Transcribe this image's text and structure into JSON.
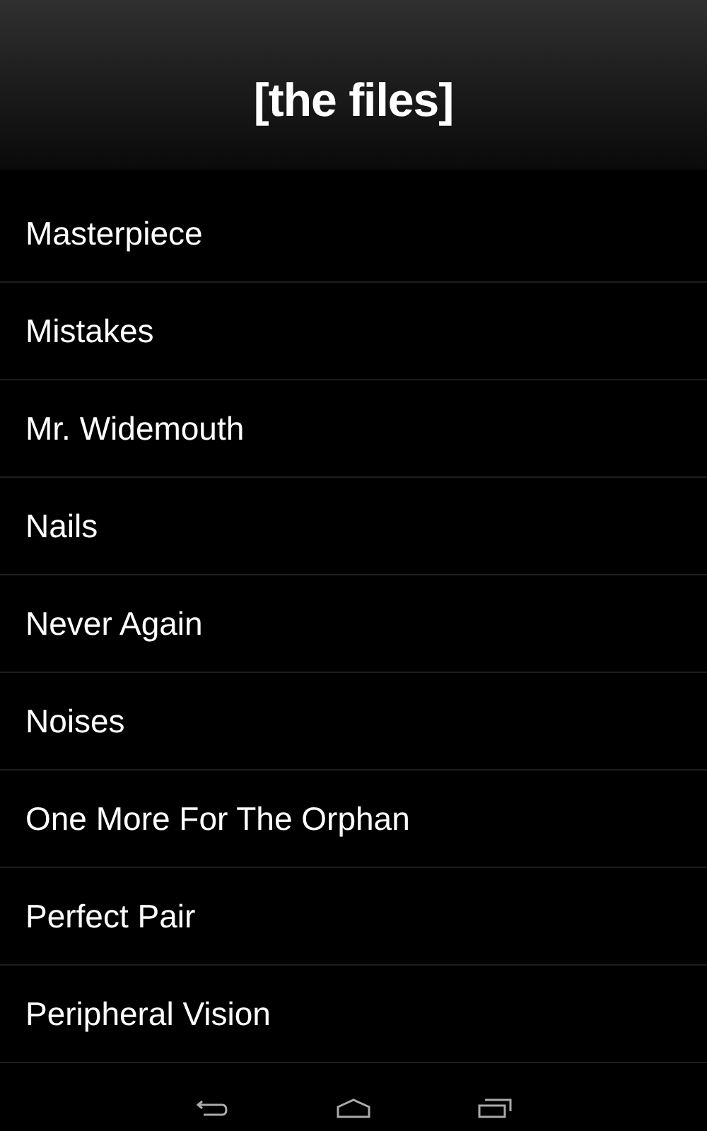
{
  "header": {
    "title": "[the files]"
  },
  "files": [
    {
      "name": "Masterpiece"
    },
    {
      "name": "Mistakes"
    },
    {
      "name": "Mr. Widemouth"
    },
    {
      "name": "Nails"
    },
    {
      "name": "Never Again"
    },
    {
      "name": "Noises"
    },
    {
      "name": "One More For The Orphan"
    },
    {
      "name": "Perfect Pair"
    },
    {
      "name": "Peripheral Vision"
    }
  ]
}
